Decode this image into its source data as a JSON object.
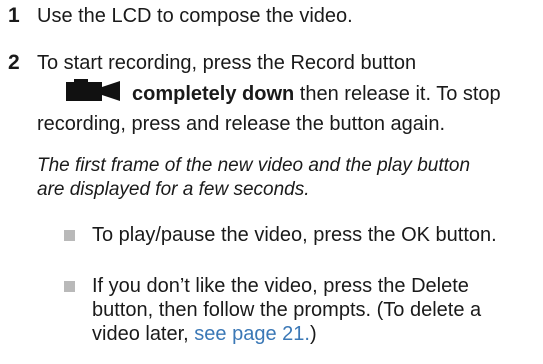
{
  "steps": [
    {
      "number": "1",
      "text": "Use the LCD to compose the video."
    },
    {
      "number": "2",
      "line1": "To start recording, press the Record button",
      "bold_text": "completely down",
      "line2_rest": " then release it. To stop",
      "line3": "recording, press and release the button again.",
      "note_line1": "The first frame of the new video and the play button",
      "note_line2": "are displayed for a few seconds."
    }
  ],
  "bullets": [
    {
      "line1": "To play/pause the video, press the OK button."
    },
    {
      "line1": "If you don’t like the video, press the Delete",
      "line2": "button, then follow the prompts. (To delete a",
      "line3_prefix": "video later, ",
      "link_text": "see page 21.",
      "line3_suffix": ")"
    }
  ],
  "icons": {
    "record": "video-camera-icon",
    "bullet": "square-bullet-icon"
  },
  "colors": {
    "text": "#1a1a1a",
    "link": "#3b78b6",
    "bullet": "#b9b9b9"
  }
}
